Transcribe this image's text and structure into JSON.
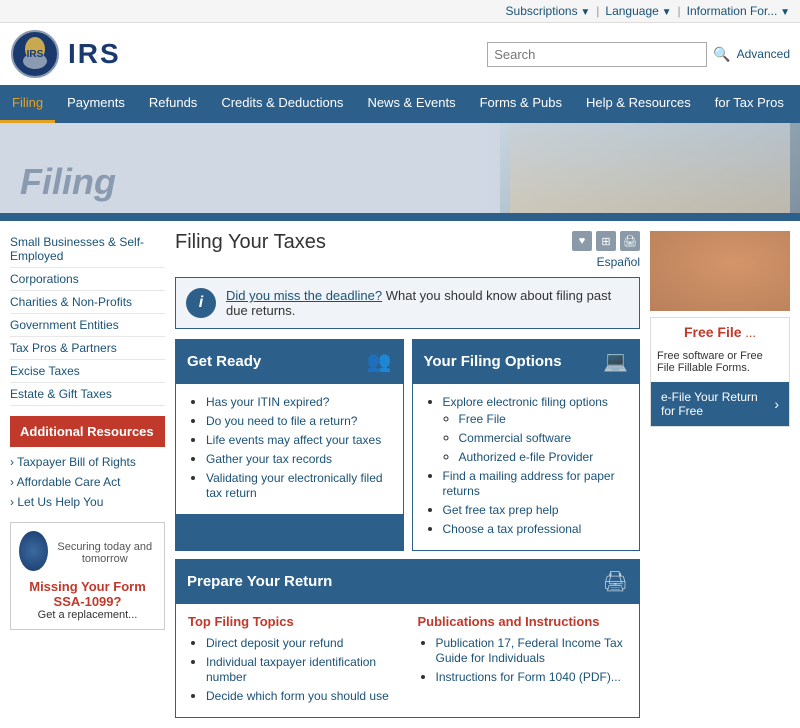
{
  "topbar": {
    "subscriptions": "Subscriptions",
    "language": "Language",
    "information_for": "Information For..."
  },
  "search": {
    "placeholder": "Search",
    "button_label": "🔍",
    "advanced": "Advanced"
  },
  "logo": {
    "text": "IRS",
    "eagle_alt": "IRS Eagle Logo"
  },
  "nav": {
    "items": [
      {
        "label": "Filing",
        "active": true
      },
      {
        "label": "Payments",
        "active": false
      },
      {
        "label": "Refunds",
        "active": false
      },
      {
        "label": "Credits & Deductions",
        "active": false
      },
      {
        "label": "News & Events",
        "active": false
      },
      {
        "label": "Forms & Pubs",
        "active": false
      },
      {
        "label": "Help & Resources",
        "active": false
      },
      {
        "label": "for Tax Pros",
        "active": false
      }
    ]
  },
  "hero": {
    "title": "Filing"
  },
  "sidebar": {
    "links": [
      "Small Businesses & Self-Employed",
      "Corporations",
      "Charities & Non-Profits",
      "Government Entities",
      "Tax Pros & Partners",
      "Excise Taxes",
      "Estate & Gift Taxes"
    ],
    "additional_resources": {
      "title": "Additional Resources",
      "links": [
        "Taxpayer Bill of Rights",
        "Affordable Care Act",
        "Let Us Help You"
      ]
    },
    "promo": {
      "text": "Securing today and tomorrow",
      "title": "Missing Your Form SSA-1099?",
      "subtitle": "Get a replacement..."
    }
  },
  "content": {
    "page_title": "Filing Your Taxes",
    "espanol": "Español",
    "info_box": {
      "link_text": "Did you miss the deadline?",
      "text": " What you should know about filing past due returns."
    },
    "get_ready": {
      "title": "Get Ready",
      "items": [
        "Has your ITIN expired?",
        "Do you need to file a return?",
        "Life events may affect your taxes",
        "Gather your tax records",
        "Validating your electronically filed tax return"
      ]
    },
    "filing_options": {
      "title": "Your Filing Options",
      "items": [
        "Explore electronic filing options",
        "Free File",
        "Commercial software",
        "Authorized e-file Provider",
        "Find a mailing address for paper returns",
        "Get free tax prep help",
        "Choose a tax professional"
      ],
      "sub_items": [
        "Free File",
        "Commercial software",
        "Authorized e-file Provider"
      ]
    },
    "prepare": {
      "title": "Prepare Your Return",
      "top_filing": {
        "title": "Top Filing Topics",
        "items": [
          "Direct deposit your refund",
          "Individual taxpayer identification number",
          "Decide which form you should use"
        ]
      },
      "publications": {
        "title": "Publications and Instructions",
        "items": [
          "Publication 17, Federal Income Tax Guide for Individuals",
          "Instructions for Form 1040 (PDF)..."
        ]
      }
    }
  },
  "right_sidebar": {
    "free_file": {
      "title": "Free File...",
      "description": "Free software or Free File Fillable Forms.",
      "efile_label": "e-File Your Return for Free",
      "arrow": "›"
    }
  }
}
